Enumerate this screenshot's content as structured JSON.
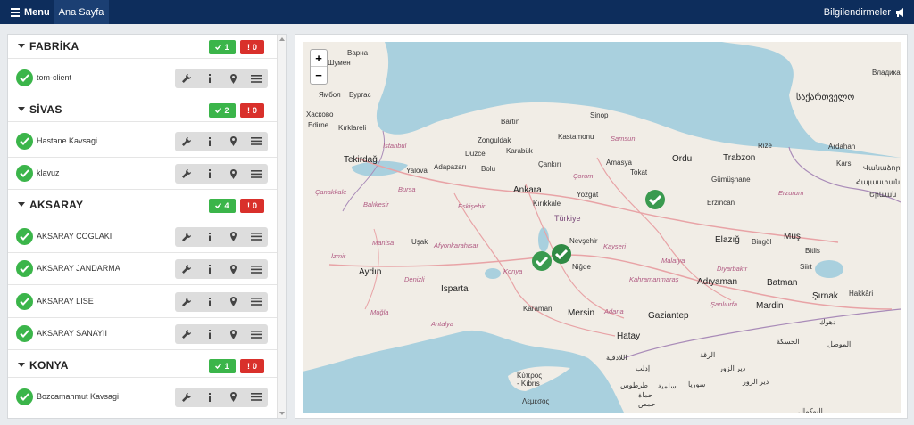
{
  "topbar": {
    "menu": "Menu",
    "home": "Ana Sayfa",
    "notifications": "Bilgilendirmeler"
  },
  "groups": [
    {
      "title": "FABRİKA",
      "ok": "1",
      "err": "0",
      "items": [
        {
          "name": "tom-client"
        }
      ]
    },
    {
      "title": "SİVAS",
      "ok": "2",
      "err": "0",
      "items": [
        {
          "name": "Hastane Kavsagi"
        },
        {
          "name": "klavuz"
        }
      ]
    },
    {
      "title": "AKSARAY",
      "ok": "4",
      "err": "0",
      "items": [
        {
          "name": "AKSARAY COGLAKI"
        },
        {
          "name": "AKSARAY JANDARMA"
        },
        {
          "name": "AKSARAY LISE"
        },
        {
          "name": "AKSARAY SANAYII"
        }
      ]
    },
    {
      "title": "KONYA",
      "ok": "1",
      "err": "0",
      "items": [
        {
          "name": "Bozcamahmut Kavsagi"
        }
      ]
    }
  ],
  "map": {
    "zoom_in": "+",
    "zoom_out": "−",
    "labels": {
      "varna": "Варна",
      "shumen": "Шумен",
      "yambol": "Ямбол",
      "burgas": "Бургас",
      "haskovo": "Хасково",
      "edirne": "Edirne",
      "kirklareli": "Kırklareli",
      "tekirdag": "Tekirdağ",
      "istanbul": "İstanbul",
      "yalova": "Yalova",
      "adapazari": "Adapazarı",
      "duzce": "Düzce",
      "bolu": "Bolu",
      "bartin": "Bartın",
      "zonguldak": "Zonguldak",
      "karabuk": "Karabük",
      "kastamonu": "Kastamonu",
      "sinop": "Sinop",
      "samsun": "Samsun",
      "cankiri": "Çankırı",
      "corum": "Çorum",
      "amasya": "Amasya",
      "tokat": "Tokat",
      "ordu": "Ordu",
      "trabzon": "Trabzon",
      "rize": "Rize",
      "gumushane": "Gümüşhane",
      "ankara": "Ankara",
      "yozgat": "Yozgat",
      "kirikkale": "Kırıkkale",
      "turkiye": "Türkiye",
      "nevsehir": "Nevşehir",
      "nigde": "Niğde",
      "kayseri": "Kayseri",
      "erzincan": "Erzincan",
      "elazig": "Elazığ",
      "mus": "Muş",
      "bingol": "Bingöl",
      "bitlis": "Bitlis",
      "siirt": "Siirt",
      "batman": "Batman",
      "sirnak": "Şırnak",
      "mardin": "Mardin",
      "adiyaman": "Adıyaman",
      "diyarbakir": "Diyarbakır",
      "malatya": "Malatya",
      "kahramanmaras": "Kahramanmaraş",
      "gaziantep": "Gaziantep",
      "adana": "Adana",
      "mersin": "Mersin",
      "karaman": "Karaman",
      "hatay": "Hatay",
      "isparta": "Isparta",
      "aydin": "Aydın",
      "usak": "Uşak",
      "eskisehir": "Eskişehir",
      "bursa": "Bursa",
      "balikesir": "Balıkesir",
      "canakkale": "Çanakkale",
      "manisa": "Manisa",
      "izmir": "İzmir",
      "denizli": "Denizli",
      "mugla": "Muğla",
      "antalya": "Antalya",
      "konya": "Konya",
      "afyon": "Afyonkarahisar",
      "sanliurfa": "Şanlıurfa",
      "hakkari": "Hakkâri",
      "ardahan": "Ardahan",
      "kars": "Kars",
      "erzurum": "Erzurum",
      "vladikav": "Владикав",
      "sakartvelo": "საქართველო",
      "hayastan": "Հայաստան",
      "yerevan": "Երևան",
      "vanadzor": "Վանաձոր",
      "dahuk": "دهوك",
      "mosul": "الموصل",
      "kibris": "Κύπρος\n- Kıbrıs",
      "lemesos": "Λεμεσός",
      "latakia": "اللاذقية",
      "syria": "سوريا",
      "hama": "حماة",
      "homs": "حمص",
      "raqqa": "الرقة",
      "deir": "دير الزور",
      "hasakah": "الحسكة",
      "idlib": "إدلب",
      "tartus": "طرطوس",
      "salamiyah": "سلمية",
      "deir2": "دير الزور",
      "abu": "البوكمال"
    }
  }
}
